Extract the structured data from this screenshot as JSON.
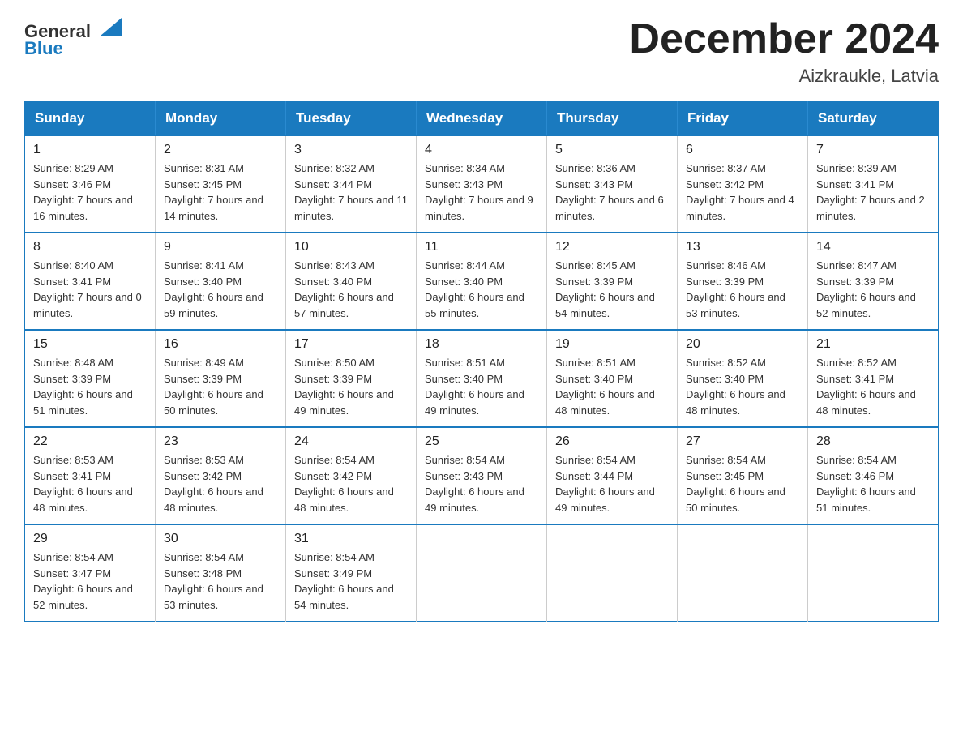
{
  "header": {
    "logo_line1": "General",
    "logo_line2": "Blue",
    "month_title": "December 2024",
    "location": "Aizkraukle, Latvia"
  },
  "weekdays": [
    "Sunday",
    "Monday",
    "Tuesday",
    "Wednesday",
    "Thursday",
    "Friday",
    "Saturday"
  ],
  "weeks": [
    [
      {
        "day": "1",
        "sunrise": "8:29 AM",
        "sunset": "3:46 PM",
        "daylight": "7 hours and 16 minutes."
      },
      {
        "day": "2",
        "sunrise": "8:31 AM",
        "sunset": "3:45 PM",
        "daylight": "7 hours and 14 minutes."
      },
      {
        "day": "3",
        "sunrise": "8:32 AM",
        "sunset": "3:44 PM",
        "daylight": "7 hours and 11 minutes."
      },
      {
        "day": "4",
        "sunrise": "8:34 AM",
        "sunset": "3:43 PM",
        "daylight": "7 hours and 9 minutes."
      },
      {
        "day": "5",
        "sunrise": "8:36 AM",
        "sunset": "3:43 PM",
        "daylight": "7 hours and 6 minutes."
      },
      {
        "day": "6",
        "sunrise": "8:37 AM",
        "sunset": "3:42 PM",
        "daylight": "7 hours and 4 minutes."
      },
      {
        "day": "7",
        "sunrise": "8:39 AM",
        "sunset": "3:41 PM",
        "daylight": "7 hours and 2 minutes."
      }
    ],
    [
      {
        "day": "8",
        "sunrise": "8:40 AM",
        "sunset": "3:41 PM",
        "daylight": "7 hours and 0 minutes."
      },
      {
        "day": "9",
        "sunrise": "8:41 AM",
        "sunset": "3:40 PM",
        "daylight": "6 hours and 59 minutes."
      },
      {
        "day": "10",
        "sunrise": "8:43 AM",
        "sunset": "3:40 PM",
        "daylight": "6 hours and 57 minutes."
      },
      {
        "day": "11",
        "sunrise": "8:44 AM",
        "sunset": "3:40 PM",
        "daylight": "6 hours and 55 minutes."
      },
      {
        "day": "12",
        "sunrise": "8:45 AM",
        "sunset": "3:39 PM",
        "daylight": "6 hours and 54 minutes."
      },
      {
        "day": "13",
        "sunrise": "8:46 AM",
        "sunset": "3:39 PM",
        "daylight": "6 hours and 53 minutes."
      },
      {
        "day": "14",
        "sunrise": "8:47 AM",
        "sunset": "3:39 PM",
        "daylight": "6 hours and 52 minutes."
      }
    ],
    [
      {
        "day": "15",
        "sunrise": "8:48 AM",
        "sunset": "3:39 PM",
        "daylight": "6 hours and 51 minutes."
      },
      {
        "day": "16",
        "sunrise": "8:49 AM",
        "sunset": "3:39 PM",
        "daylight": "6 hours and 50 minutes."
      },
      {
        "day": "17",
        "sunrise": "8:50 AM",
        "sunset": "3:39 PM",
        "daylight": "6 hours and 49 minutes."
      },
      {
        "day": "18",
        "sunrise": "8:51 AM",
        "sunset": "3:40 PM",
        "daylight": "6 hours and 49 minutes."
      },
      {
        "day": "19",
        "sunrise": "8:51 AM",
        "sunset": "3:40 PM",
        "daylight": "6 hours and 48 minutes."
      },
      {
        "day": "20",
        "sunrise": "8:52 AM",
        "sunset": "3:40 PM",
        "daylight": "6 hours and 48 minutes."
      },
      {
        "day": "21",
        "sunrise": "8:52 AM",
        "sunset": "3:41 PM",
        "daylight": "6 hours and 48 minutes."
      }
    ],
    [
      {
        "day": "22",
        "sunrise": "8:53 AM",
        "sunset": "3:41 PM",
        "daylight": "6 hours and 48 minutes."
      },
      {
        "day": "23",
        "sunrise": "8:53 AM",
        "sunset": "3:42 PM",
        "daylight": "6 hours and 48 minutes."
      },
      {
        "day": "24",
        "sunrise": "8:54 AM",
        "sunset": "3:42 PM",
        "daylight": "6 hours and 48 minutes."
      },
      {
        "day": "25",
        "sunrise": "8:54 AM",
        "sunset": "3:43 PM",
        "daylight": "6 hours and 49 minutes."
      },
      {
        "day": "26",
        "sunrise": "8:54 AM",
        "sunset": "3:44 PM",
        "daylight": "6 hours and 49 minutes."
      },
      {
        "day": "27",
        "sunrise": "8:54 AM",
        "sunset": "3:45 PM",
        "daylight": "6 hours and 50 minutes."
      },
      {
        "day": "28",
        "sunrise": "8:54 AM",
        "sunset": "3:46 PM",
        "daylight": "6 hours and 51 minutes."
      }
    ],
    [
      {
        "day": "29",
        "sunrise": "8:54 AM",
        "sunset": "3:47 PM",
        "daylight": "6 hours and 52 minutes."
      },
      {
        "day": "30",
        "sunrise": "8:54 AM",
        "sunset": "3:48 PM",
        "daylight": "6 hours and 53 minutes."
      },
      {
        "day": "31",
        "sunrise": "8:54 AM",
        "sunset": "3:49 PM",
        "daylight": "6 hours and 54 minutes."
      },
      null,
      null,
      null,
      null
    ]
  ],
  "labels": {
    "sunrise": "Sunrise:",
    "sunset": "Sunset:",
    "daylight": "Daylight:"
  }
}
